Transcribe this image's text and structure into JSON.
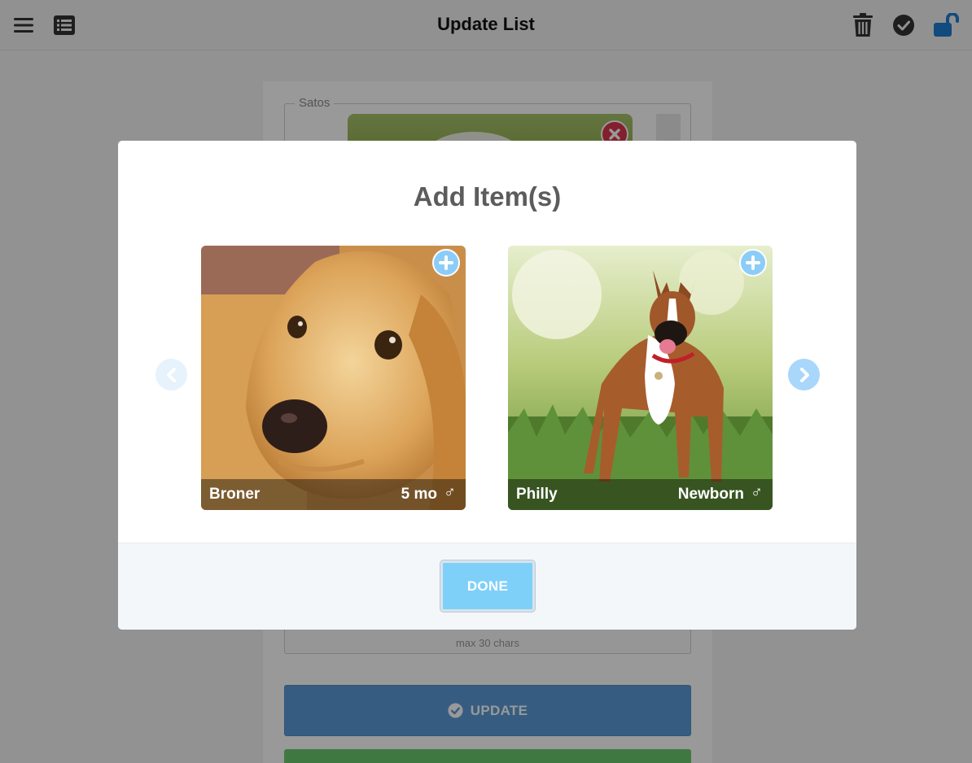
{
  "header": {
    "title": "Update List",
    "icons": [
      "menu-icon",
      "list-icon",
      "trash-icon",
      "check-circle-icon",
      "unlock-icon"
    ]
  },
  "form": {
    "fieldset_legend": "Satos",
    "max_hint": "max 30 chars",
    "update_label": "UPDATE"
  },
  "modal": {
    "title": "Add Item(s)",
    "done_label": "DONE",
    "items": [
      {
        "name": "Broner",
        "age": "5 mo",
        "sex_symbol": "♂",
        "sex": "male"
      },
      {
        "name": "Philly",
        "age": "Newborn",
        "sex_symbol": "♂",
        "sex": "male"
      }
    ]
  },
  "colors": {
    "accent_blue": "#7fd0f9",
    "update_blue": "#5b9bd8",
    "remove_red": "#d9364b",
    "unlock_blue": "#1f7ed1",
    "green": "#6cc96f"
  }
}
